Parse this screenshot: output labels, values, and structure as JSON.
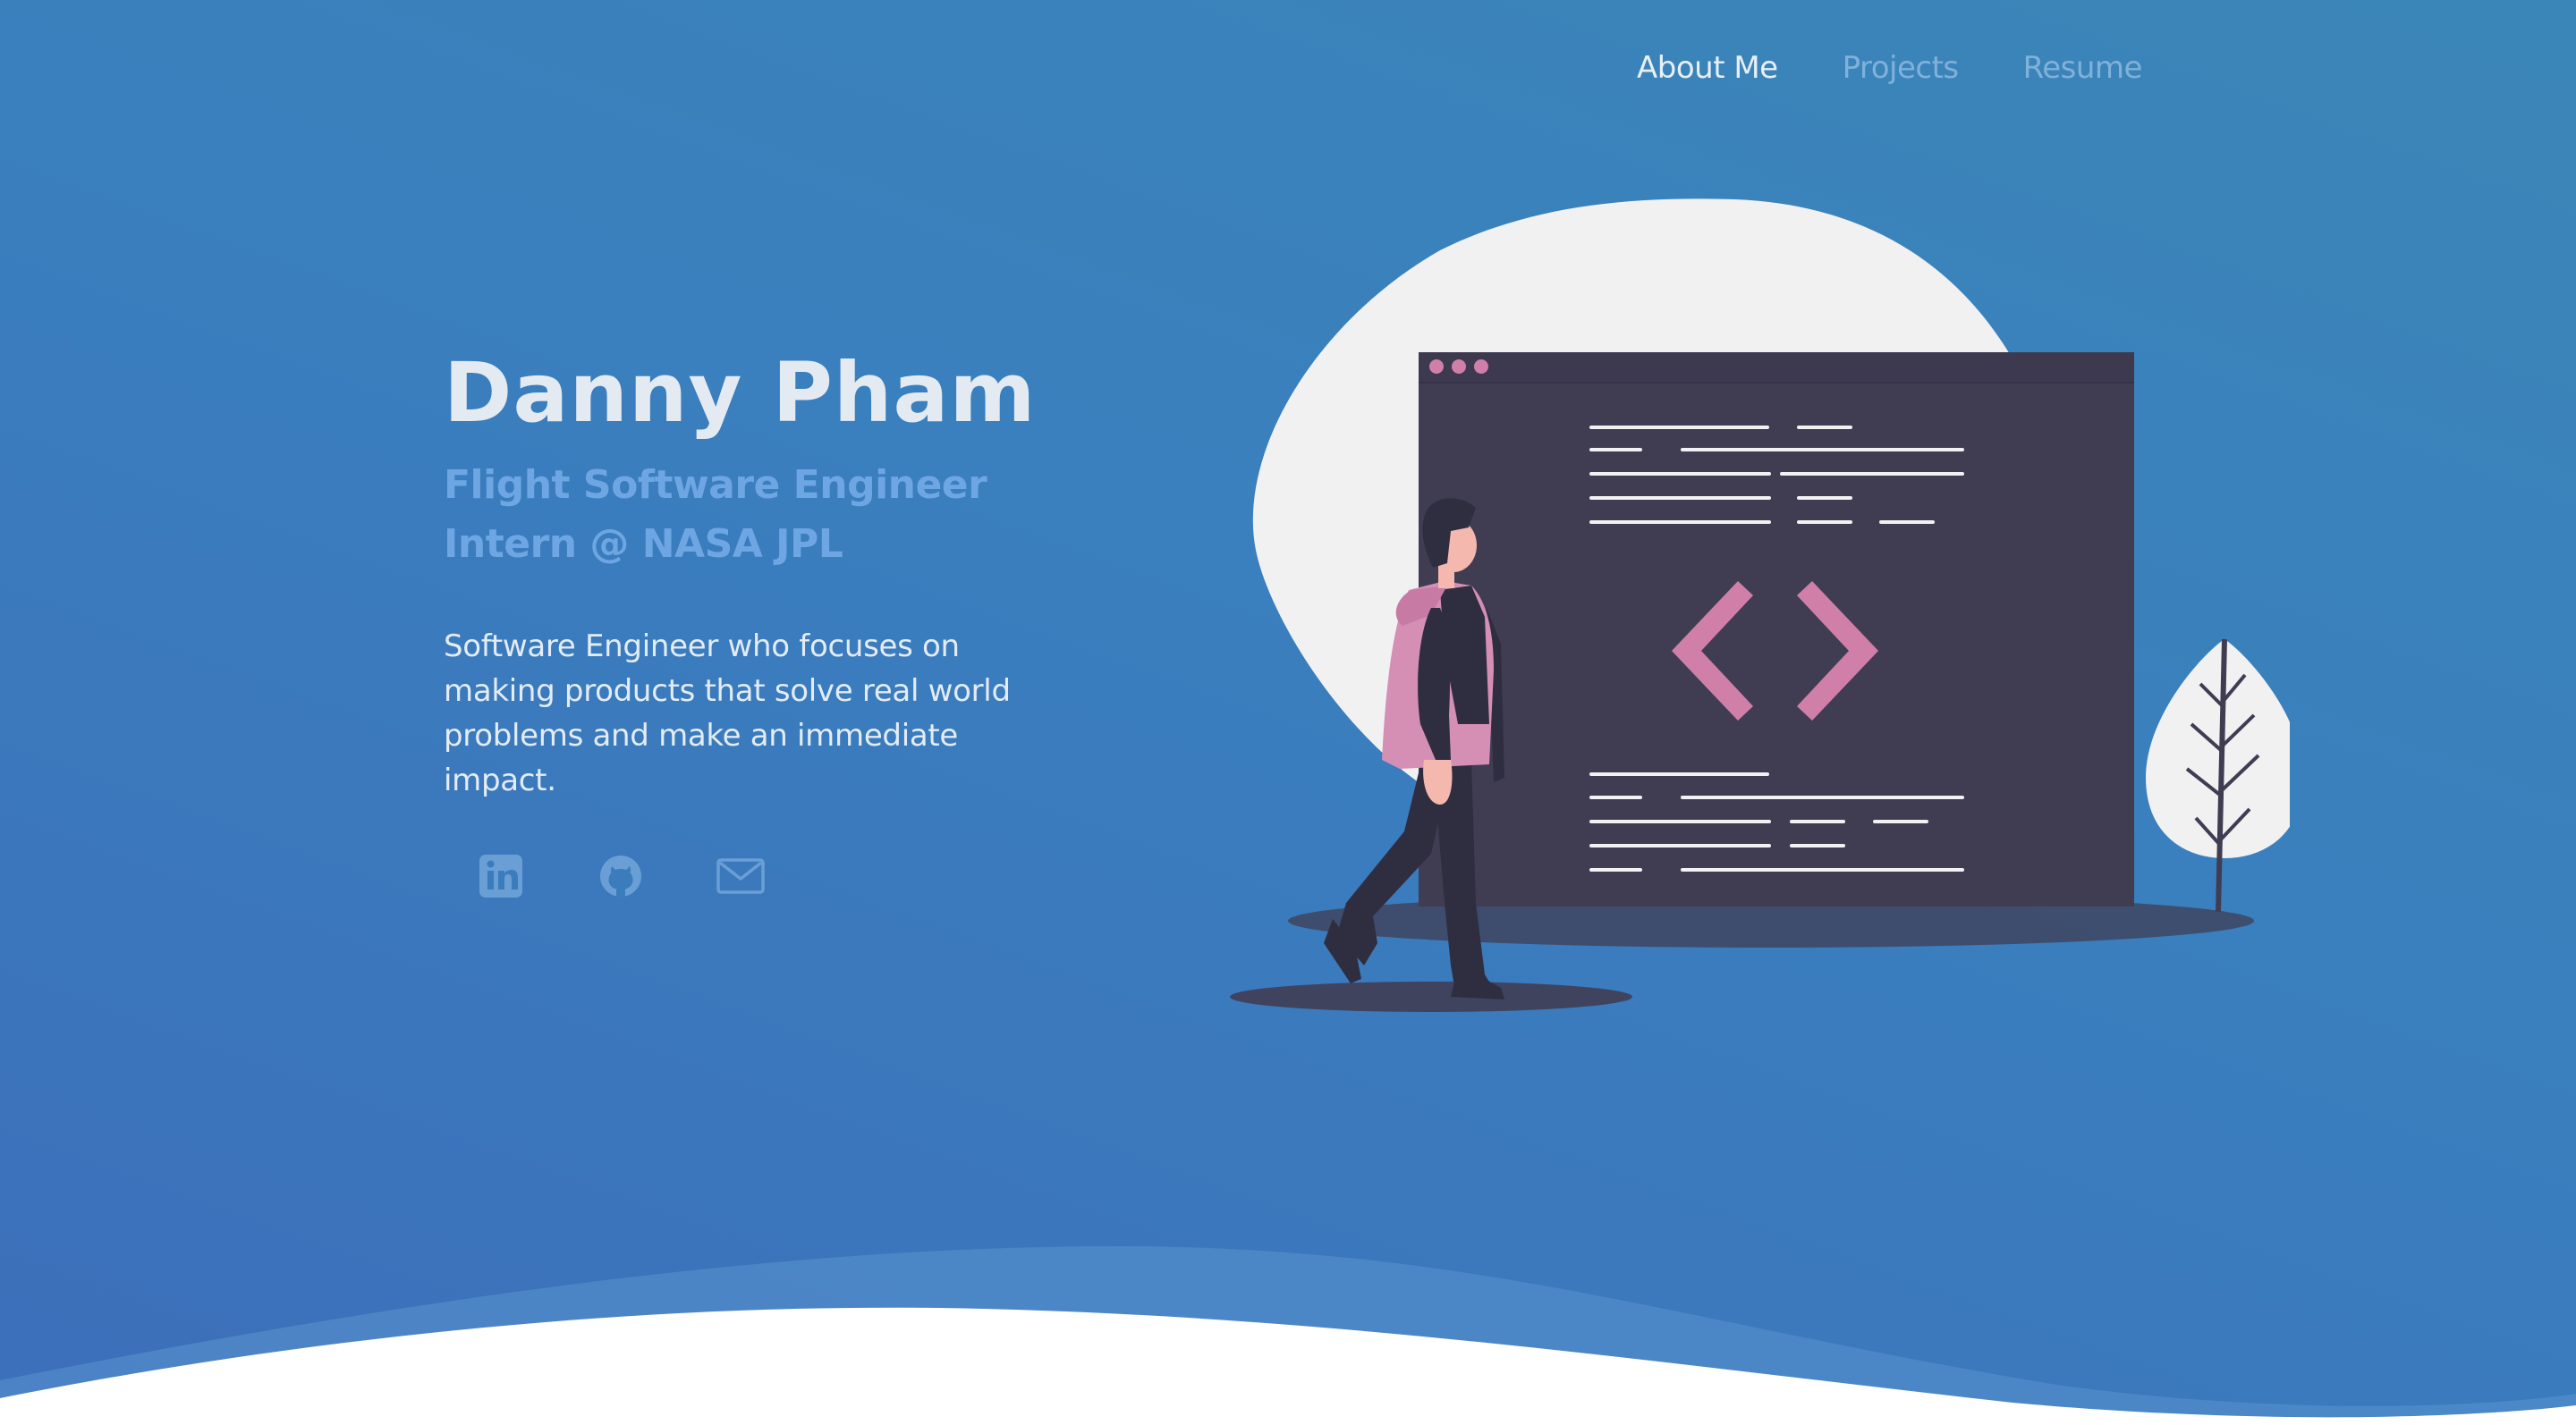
{
  "nav": {
    "items": [
      {
        "label": "About Me",
        "active": true
      },
      {
        "label": "Projects",
        "active": false
      },
      {
        "label": "Resume",
        "active": false
      }
    ]
  },
  "hero": {
    "name": "Danny Pham",
    "role": "Flight Software Engineer Intern @ NASA JPL",
    "bio": "Software Engineer who focuses on making products that solve real world problems and make an immediate impact."
  },
  "socials": [
    {
      "icon": "linkedin-icon"
    },
    {
      "icon": "github-icon"
    },
    {
      "icon": "mail-icon"
    }
  ],
  "colors": {
    "background_top": "#3b86b8",
    "background_bottom": "#3c6fba",
    "accent_pink": "#d07fa9",
    "window_dark": "#403d53",
    "blob_light": "#f1f1f2",
    "subtitle_blue": "#6ea6e4",
    "text_light": "#e3eaf1"
  }
}
